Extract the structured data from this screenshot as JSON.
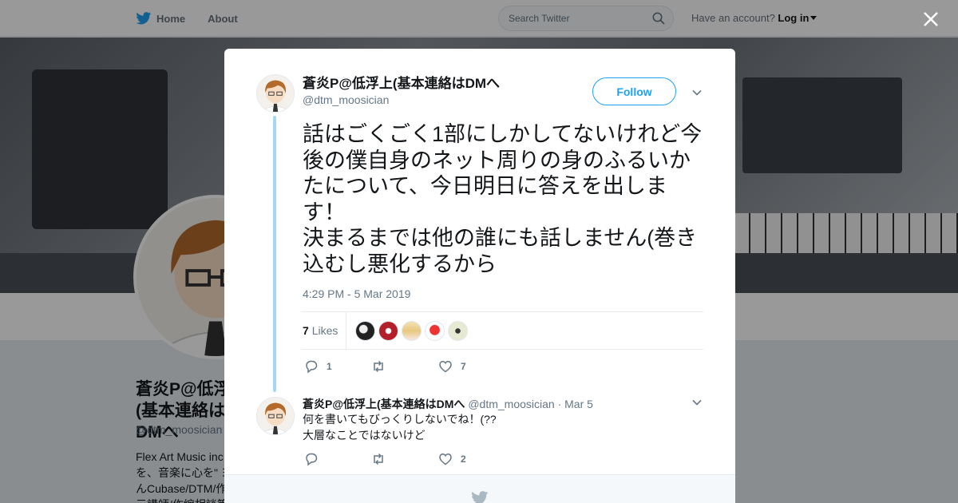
{
  "nav": {
    "home_label": "Home",
    "about_label": "About"
  },
  "search": {
    "placeholder": "Search Twitter"
  },
  "account": {
    "prompt": "Have an account?",
    "login_label": "Log in"
  },
  "profile": {
    "name": "蒼炎P@低浮上(基本連絡はDMへ",
    "handle": "@dtm_moosician",
    "bio": "Flex Art Music inc\nを、音楽に心を\" ヨ\nんCubase/DTM/作\n元講師/作編相談等"
  },
  "tweet": {
    "author_name": "蒼炎P@低浮上(基本連絡はDMへ",
    "author_handle": "@dtm_moosician",
    "follow_label": "Follow",
    "text": "話はごくごく1部にしかしてないけれど今後の僕自身のネット周りの身のふるいかたについて、今日明日に答えを出します！\n決まるまでは他の誰にも話しません(巻き込むし悪化するから",
    "timestamp": "4:29 PM - 5 Mar 2019",
    "likes_count": "7",
    "likes_label": "Likes",
    "reply_count": "1",
    "retweet_count": "",
    "like_count": "7"
  },
  "reply": {
    "author_name": "蒼炎P@低浮上(基本連絡はDMへ",
    "author_handle": "@dtm_moosician",
    "date": "· Mar 5",
    "text": "何を書いてもびっくりしないでね！(??\n大層なことではないけど",
    "reply_count": "",
    "retweet_count": "",
    "like_count": "2"
  },
  "colors": {
    "accent": "#1da1f2",
    "thread": "#a5d6f3",
    "muted": "#657786"
  },
  "icons": [
    "twitter-bird-icon",
    "search-icon",
    "close-icon",
    "chevron-down-icon",
    "reply-icon",
    "retweet-icon",
    "heart-icon"
  ]
}
